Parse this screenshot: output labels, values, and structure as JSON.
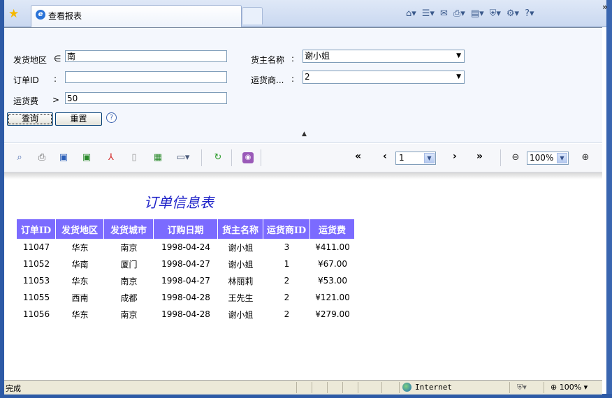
{
  "browser": {
    "tab_title": "查看报表",
    "more_chevron": "»",
    "status_text": "完成",
    "zone": "Internet",
    "zoom": "100%"
  },
  "query": {
    "region_label": "发货地区",
    "region_op": "∈",
    "region_value": "南",
    "order_label": "订单ID",
    "order_op": ":",
    "order_value": "",
    "freight_label": "运货费",
    "freight_op": ">",
    "freight_value": "50",
    "owner_label": "货主名称",
    "owner_op": ":",
    "owner_value": "谢小姐",
    "shipper_label": "运货商...",
    "shipper_op": ":",
    "shipper_value": "2",
    "search_button": "查询",
    "reset_button": "重置"
  },
  "toolbar": {
    "first_page": "«",
    "prev_page": "‹",
    "page_value": "1",
    "next_page": "›",
    "last_page": "»",
    "zoom_value": "100%"
  },
  "report": {
    "title": "订单信息表",
    "headers": [
      "订单ID",
      "发货地区",
      "发货城市",
      "订购日期",
      "货主名称",
      "运货商ID",
      "运货费"
    ],
    "rows": [
      [
        "11047",
        "华东",
        "南京",
        "1998-04-24",
        "谢小姐",
        "3",
        "¥411.00"
      ],
      [
        "11052",
        "华南",
        "厦门",
        "1998-04-27",
        "谢小姐",
        "1",
        "¥67.00"
      ],
      [
        "11053",
        "华东",
        "南京",
        "1998-04-27",
        "林丽莉",
        "2",
        "¥53.00"
      ],
      [
        "11055",
        "西南",
        "成都",
        "1998-04-28",
        "王先生",
        "2",
        "¥121.00"
      ],
      [
        "11056",
        "华东",
        "南京",
        "1998-04-28",
        "谢小姐",
        "2",
        "¥279.00"
      ]
    ]
  }
}
